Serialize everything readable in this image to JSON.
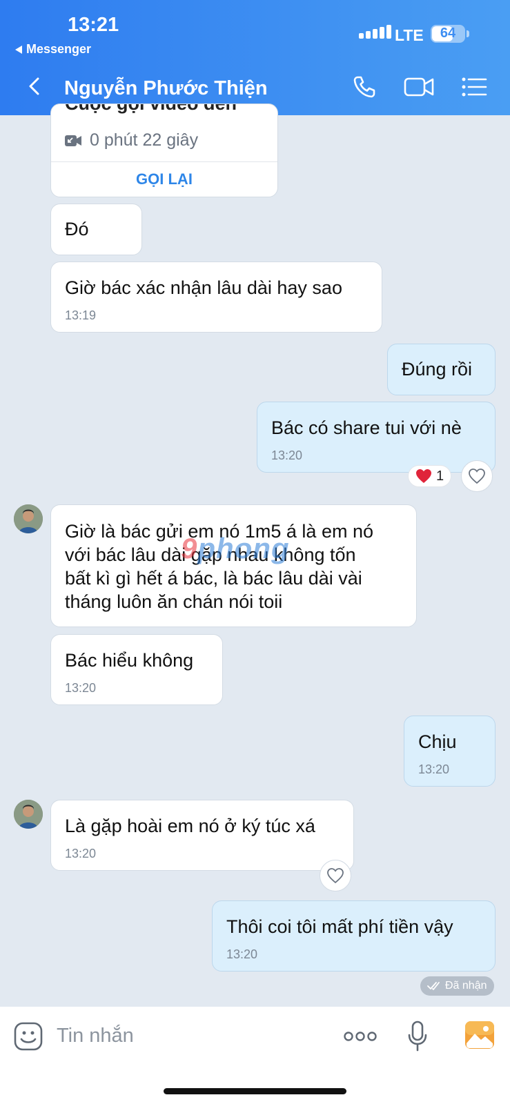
{
  "status_bar": {
    "time": "13:21",
    "back_app": "Messenger",
    "network": "LTE",
    "battery": "64"
  },
  "header": {
    "contact_name": "Nguyễn Phước Thiện",
    "icons": [
      "back-arrow-icon",
      "phone-icon",
      "video-camera-icon",
      "menu-list-icon"
    ]
  },
  "call_card": {
    "title_partial": "Cuộc gọi video đến",
    "duration": "0 phút 22 giây",
    "recall_label": "GỌI LẠI"
  },
  "messages": [
    {
      "from": "them",
      "text": "Đó",
      "time": ""
    },
    {
      "from": "them",
      "text": "Giờ bác xác nhận lâu dài hay sao",
      "time": "13:19"
    },
    {
      "from": "me",
      "text": "Đúng rồi",
      "time": ""
    },
    {
      "from": "me",
      "text": "Bác có share tui với nè",
      "time": "13:20",
      "reaction_count": "1"
    },
    {
      "from": "them",
      "lines": [
        "Giờ là bác gửi em nó 1m5 á là em nó",
        "với bác lâu dài gặp nhau không tốn",
        "bất kì gì hết á bác, là bác lâu dài vài",
        "tháng luôn ăn chán nói toii"
      ],
      "time": ""
    },
    {
      "from": "them",
      "text": "Bác hiểu không",
      "time": "13:20"
    },
    {
      "from": "me",
      "text": "Chịu",
      "time": "13:20"
    },
    {
      "from": "them",
      "text": "Là gặp hoài em nó ở ký túc xá",
      "time": "13:20"
    },
    {
      "from": "me",
      "text": "Thôi coi tôi mất phí tiền vậy",
      "time": "13:20"
    }
  ],
  "seen_status": "Đã nhận",
  "watermark": {
    "part1": "9",
    "part2": "phong"
  },
  "input": {
    "placeholder": "Tin nhắn"
  },
  "colors": {
    "header_start": "#2e7cf0",
    "header_end": "#4a9ef3",
    "my_bubble": "#dbeffc",
    "their_bubble": "#ffffff",
    "chat_bg": "#e2e9f1",
    "accent": "#2e86e8"
  }
}
